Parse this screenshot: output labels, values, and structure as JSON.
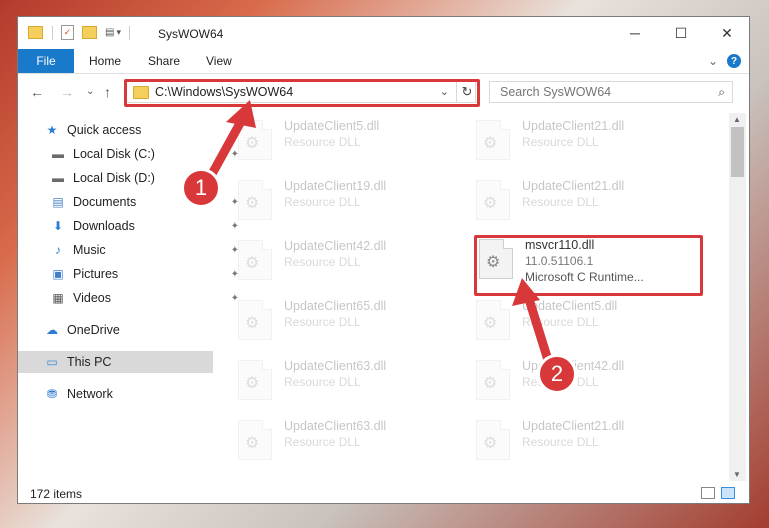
{
  "window": {
    "title": "SysWOW64",
    "controls": {
      "minimize": "─",
      "maximize": "☐",
      "close": "✕"
    }
  },
  "ribbon": {
    "tabs": [
      "File",
      "Home",
      "Share",
      "View"
    ],
    "collapse_glyph": "⌄",
    "help_glyph": "?"
  },
  "nav": {
    "back": "←",
    "forward": "→",
    "recent": "⌄",
    "up": "↑",
    "address": "C:\\Windows\\SysWOW64",
    "address_chevron": "⌄",
    "refresh": "↻",
    "search_placeholder": "Search SysWOW64",
    "search_icon": "⌕"
  },
  "sidebar": {
    "items": [
      {
        "label": "Quick access",
        "icon": "star-icon",
        "glyph": "★",
        "color": "#2b7bd1"
      },
      {
        "label": "Local Disk (C:)",
        "icon": "drive-icon",
        "glyph": "▬",
        "color": "#6b6b6b",
        "pinned": true
      },
      {
        "label": "Local Disk (D:)",
        "icon": "drive-icon",
        "glyph": "▬",
        "color": "#6b6b6b"
      },
      {
        "label": "Documents",
        "icon": "documents-icon",
        "glyph": "▤",
        "color": "#4a7fc1",
        "pinned": true
      },
      {
        "label": "Downloads",
        "icon": "download-icon",
        "glyph": "⬇",
        "color": "#2b7bd1",
        "pinned": true
      },
      {
        "label": "Music",
        "icon": "music-icon",
        "glyph": "♪",
        "color": "#2b7bd1",
        "pinned": true
      },
      {
        "label": "Pictures",
        "icon": "pictures-icon",
        "glyph": "▣",
        "color": "#3d7fc9",
        "pinned": true
      },
      {
        "label": "Videos",
        "icon": "videos-icon",
        "glyph": "▦",
        "color": "#555",
        "pinned": true
      },
      {
        "label": "OneDrive",
        "icon": "cloud-icon",
        "glyph": "☁",
        "color": "#2b7bd1"
      },
      {
        "label": "This PC",
        "icon": "computer-icon",
        "glyph": "▭",
        "color": "#3a8dde",
        "selected": true
      },
      {
        "label": "Network",
        "icon": "network-icon",
        "glyph": "⛃",
        "color": "#2b7bd1"
      }
    ],
    "pin_glyph": "📌"
  },
  "files": [
    {
      "name": "UpdateClient5.dll",
      "type": "Resource DLL",
      "faded": true
    },
    {
      "name": "UpdateClient21.dll",
      "type": "Resource DLL",
      "faded": true
    },
    {
      "name": "UpdateClient19.dll",
      "type": "Resource DLL",
      "faded": true
    },
    {
      "name": "UpdateClient21.dll",
      "type": "Resource DLL",
      "faded": true
    },
    {
      "name": "UpdateClient42.dll",
      "type": "Resource DLL",
      "faded": true
    },
    {
      "name": "msvcr110.dll",
      "type": "11.0.51106.1",
      "description": "Microsoft C Runtime...",
      "faded": false
    },
    {
      "name": "UpdateClient65.dll",
      "type": "Resource DLL",
      "faded": true
    },
    {
      "name": "UpdateClient5.dll",
      "type": "Resource DLL",
      "faded": true
    },
    {
      "name": "UpdateClient63.dll",
      "type": "Resource DLL",
      "faded": true
    },
    {
      "name": "UpdateClient42.dll",
      "type": "Resource DLL",
      "faded": true
    },
    {
      "name": "UpdateClient63.dll",
      "type": "Resource DLL",
      "faded": true
    },
    {
      "name": "UpdateClient21.dll",
      "type": "Resource DLL",
      "faded": true
    }
  ],
  "status": {
    "item_count": "172 items"
  },
  "callouts": {
    "one": "1",
    "two": "2",
    "color": "#d9383a"
  }
}
